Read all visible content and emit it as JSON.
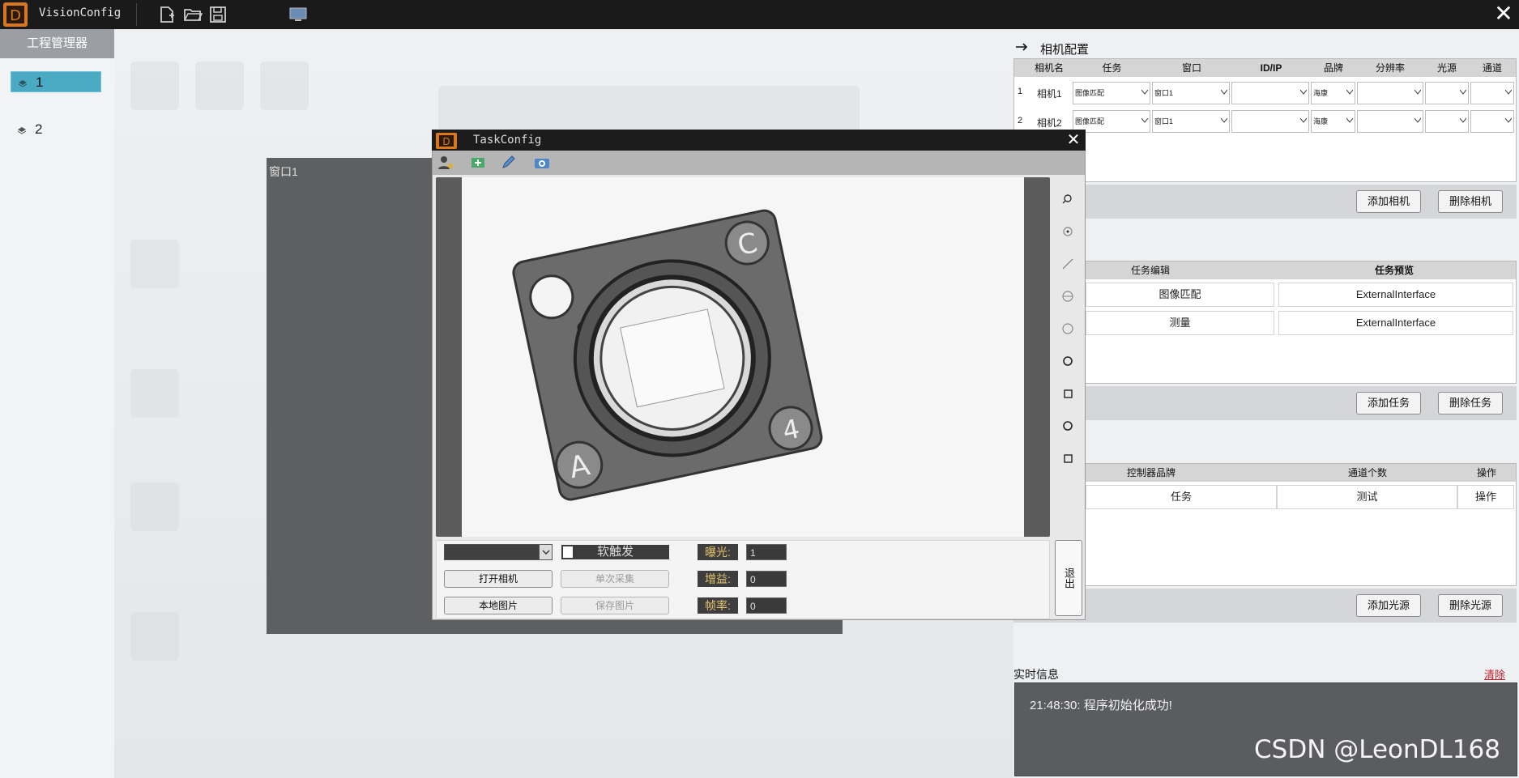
{
  "app": {
    "title": "VisionConfig"
  },
  "left_panel": {
    "header": "工程管理器",
    "items": [
      {
        "label": "1"
      },
      {
        "label": "2"
      }
    ]
  },
  "window1": {
    "title": "窗口1"
  },
  "task_dialog": {
    "title": "TaskConfig",
    "controls": {
      "soft_trigger": "软触发",
      "open_camera": "打开相机",
      "single_capture": "单次采集",
      "local_image": "本地图片",
      "save_image": "保存图片",
      "exposure_label": "曝光:",
      "exposure_value": "1",
      "gain_label": "增益:",
      "gain_value": "0",
      "framerate_label": "帧率:",
      "framerate_value": "0",
      "exit": "退出"
    }
  },
  "camera_config": {
    "title": "相机配置",
    "columns": [
      "相机名",
      "任务",
      "窗口",
      "ID/IP",
      "品牌",
      "分辨率",
      "光源",
      "通道"
    ],
    "rows": [
      {
        "index": "1",
        "name": "相机1",
        "task": "图像匹配",
        "window": "窗口1",
        "brand": "海康"
      },
      {
        "index": "2",
        "name": "相机2",
        "task": "图像匹配",
        "window": "窗口1",
        "brand": "海康"
      }
    ],
    "add_button": "添加相机",
    "delete_button": "删除相机"
  },
  "task_config": {
    "columns": [
      "任务编辑",
      "任务预览"
    ],
    "rows": [
      {
        "edit": "图像匹配",
        "preview": "ExternalInterface"
      },
      {
        "edit": "测量",
        "preview": "ExternalInterface"
      }
    ],
    "add_button": "添加任务",
    "delete_button": "删除任务"
  },
  "light_config": {
    "columns": [
      "控制器品牌",
      "通道个数",
      "操作"
    ],
    "rows": [
      {
        "brand": "任务",
        "channels": "测试",
        "op": "操作"
      }
    ],
    "add_button": "添加光源",
    "delete_button": "删除光源"
  },
  "log": {
    "title": "实时信息",
    "clear": "清除",
    "lines": [
      "21:48:30: 程序初始化成功!"
    ]
  },
  "watermark": "CSDN @LeonDL168",
  "colors": {
    "accent_selected": "#4aa9c3",
    "title_bar": "#1a1a1a",
    "logo": "#d9771f",
    "log_bg": "#5a5c5f"
  }
}
